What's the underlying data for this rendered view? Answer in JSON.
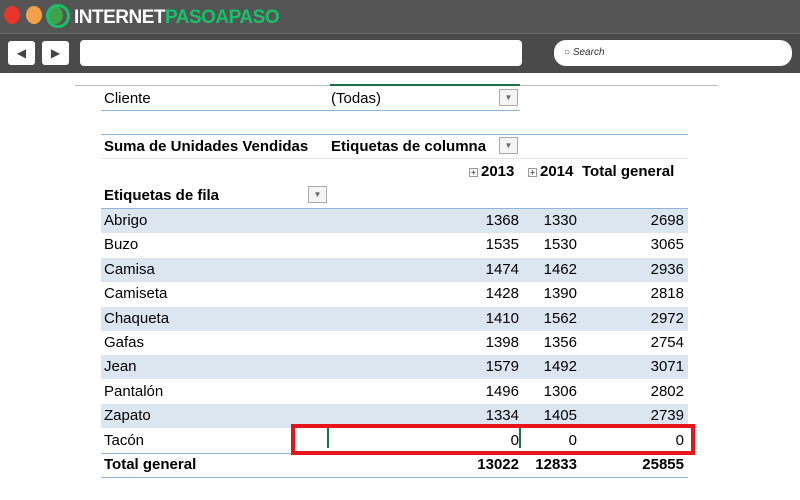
{
  "browser": {
    "brand_white": "INTERNET",
    "brand_green": "PASOAPASO",
    "search_placeholder": "Search",
    "back_icon": "◀",
    "forward_icon": "▶"
  },
  "filter": {
    "label": "Cliente",
    "value": "(Todas)"
  },
  "pivot": {
    "value_header": "Suma de Unidades Vendidas",
    "column_labels": "Etiquetas de columna",
    "row_labels": "Etiquetas de fila",
    "columns": [
      "2013",
      "2014",
      "Total general"
    ],
    "rows": [
      {
        "label": "Abrigo",
        "v": [
          "1368",
          "1330",
          "2698"
        ]
      },
      {
        "label": "Buzo",
        "v": [
          "1535",
          "1530",
          "3065"
        ]
      },
      {
        "label": "Camisa",
        "v": [
          "1474",
          "1462",
          "2936"
        ]
      },
      {
        "label": "Camiseta",
        "v": [
          "1428",
          "1390",
          "2818"
        ]
      },
      {
        "label": "Chaqueta",
        "v": [
          "1410",
          "1562",
          "2972"
        ]
      },
      {
        "label": "Gafas",
        "v": [
          "1398",
          "1356",
          "2754"
        ]
      },
      {
        "label": "Jean",
        "v": [
          "1579",
          "1492",
          "3071"
        ]
      },
      {
        "label": "Pantalón",
        "v": [
          "1496",
          "1306",
          "2802"
        ]
      },
      {
        "label": "Zapato",
        "v": [
          "1334",
          "1405",
          "2739"
        ]
      },
      {
        "label": "Tacón",
        "v": [
          "0",
          "0",
          "0"
        ]
      }
    ],
    "total": {
      "label": "Total general",
      "v": [
        "13022",
        "12833",
        "25855"
      ]
    }
  },
  "colors": {
    "band": "#dce6f1",
    "highlight": "#e8141c",
    "accent": "#19c06a"
  }
}
